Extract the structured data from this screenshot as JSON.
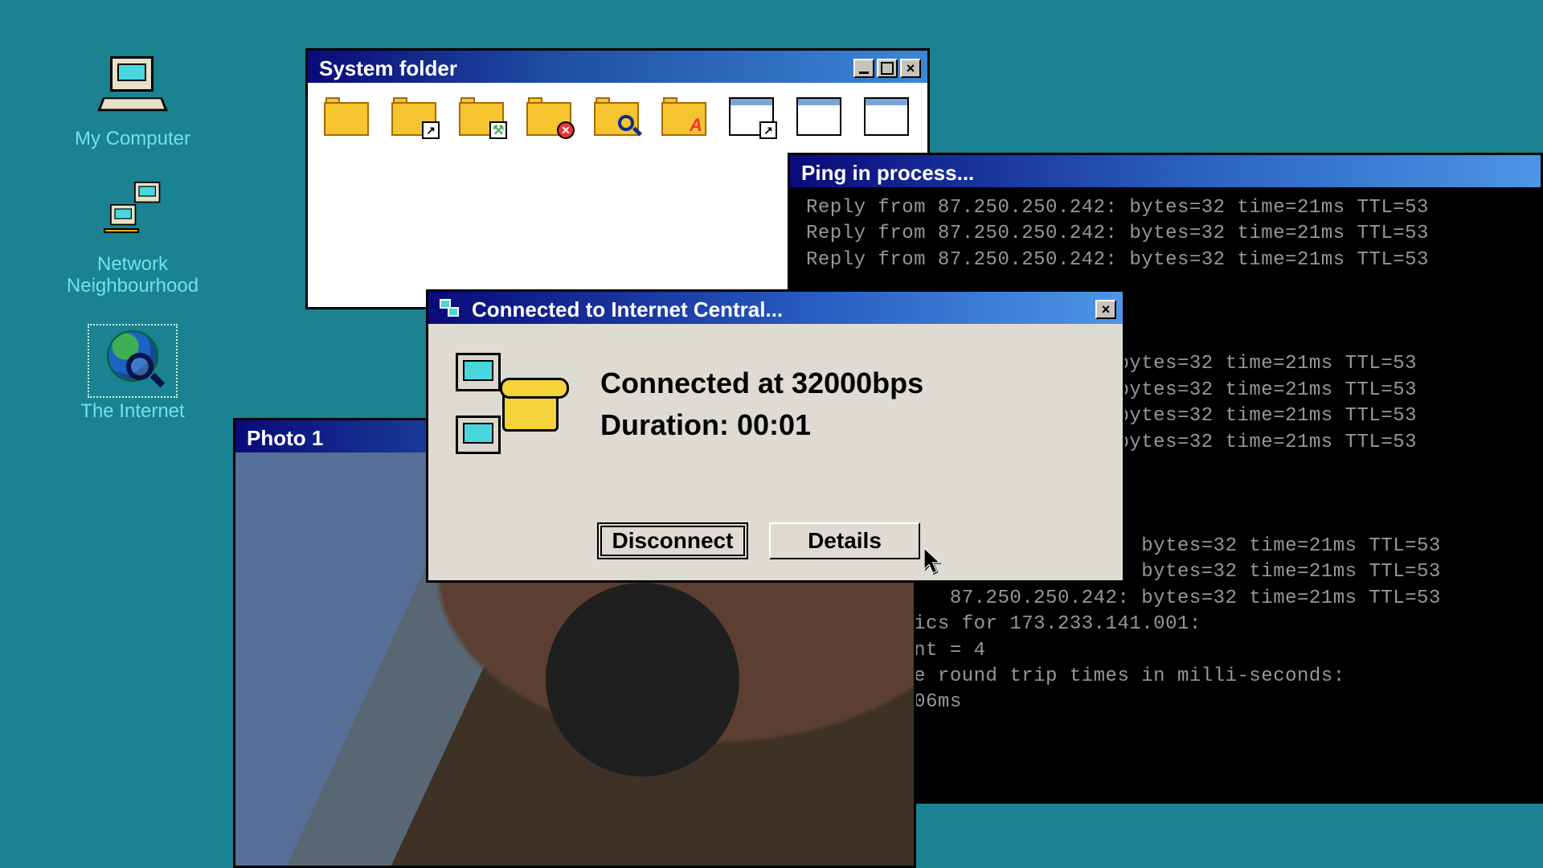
{
  "desktop": {
    "icons": [
      {
        "id": "my-computer",
        "label": "My Computer"
      },
      {
        "id": "network",
        "label": "Network\nNeighbourhood"
      },
      {
        "id": "internet",
        "label": "The Internet",
        "selected": true
      }
    ]
  },
  "system_folder": {
    "title": "System folder",
    "items": [
      {
        "kind": "folder",
        "name": "folder-plain"
      },
      {
        "kind": "folder",
        "name": "folder-shortcut",
        "badge": "arrow"
      },
      {
        "kind": "folder",
        "name": "folder-tools",
        "badge": "tools"
      },
      {
        "kind": "folder",
        "name": "folder-error",
        "badge": "err"
      },
      {
        "kind": "folder",
        "name": "folder-search",
        "badge": "search"
      },
      {
        "kind": "folder",
        "name": "folder-fonts",
        "badge": "font"
      },
      {
        "kind": "appwin",
        "name": "window-shortcut",
        "badge": "arrow"
      },
      {
        "kind": "appwin",
        "name": "window-user"
      },
      {
        "kind": "appwin",
        "name": "window-colors"
      }
    ]
  },
  "ping": {
    "title": "Ping in process...",
    "lines": [
      "Reply from 87.250.250.242: bytes=32 time=21ms TTL=53",
      "Reply from 87.250.250.242: bytes=32 time=21ms TTL=53",
      "Reply from 87.250.250.242: bytes=32 time=21ms TTL=53",
      "",
      "",
      "",
      "                       2: bytes=32 time=21ms TTL=53",
      "                       2: bytes=32 time=21ms TTL=53",
      "                       2: bytes=32 time=21ms TTL=53",
      "                       2: bytes=32 time=21ms TTL=53",
      "",
      "",
      "",
      "            87.250.250.242: bytes=32 time=21ms TTL=53",
      "            87.250.250.242: bytes=32 time=21ms TTL=53",
      "            87.250.250.242: bytes=32 time=21ms TTL=53",
      "         ics for 173.233.141.001:",
      "         nt = 4",
      "         e round trip times in milli-seconds:",
      "         06ms"
    ]
  },
  "photo": {
    "title": "Photo 1"
  },
  "connection": {
    "title": "Connected to Internet Central...",
    "speed_line": "Connected at 32000bps",
    "duration_line": "Duration: 00:01",
    "buttons": {
      "disconnect": "Disconnect",
      "details": "Details"
    }
  }
}
